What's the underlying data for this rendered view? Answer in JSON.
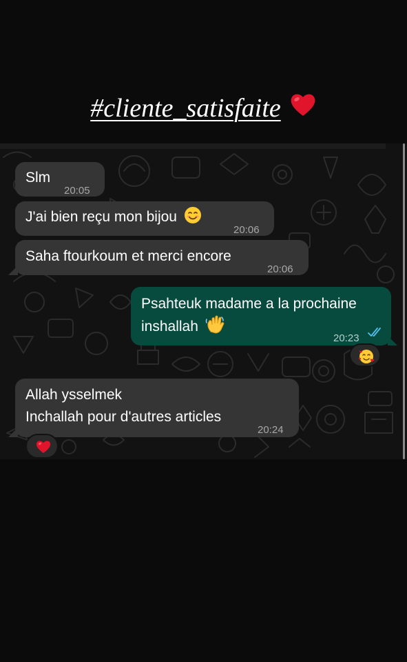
{
  "caption": {
    "text": "#cliente_satisfaite",
    "heart_icon": "red-heart-icon"
  },
  "chat": {
    "messages": [
      {
        "direction": "incoming",
        "text": "Slm",
        "time": "20:05"
      },
      {
        "direction": "incoming",
        "text": "J'ai bien reçu mon bijou",
        "emoji": "smiling-face-emoji",
        "time": "20:06"
      },
      {
        "direction": "incoming",
        "text": "Saha ftourkoum et merci encore",
        "time": "20:06"
      },
      {
        "direction": "outgoing",
        "lines": [
          "Psahteuk madame a la prochaine",
          "inshallah"
        ],
        "emoji": "waving-hand-emoji",
        "time": "20:23",
        "status": "read-double-check-icon",
        "reaction": "smiling-face-with-hearts-emoji"
      },
      {
        "direction": "incoming",
        "lines": [
          "Allah ysselmek",
          "Inchallah pour d'autres articles"
        ],
        "time": "20:24",
        "reaction": "red-heart-emoji"
      }
    ]
  },
  "colors": {
    "incoming_bubble": "#353535",
    "outgoing_bubble": "#074b3f",
    "read_ticks": "#53bdeb",
    "heart": "#e0152b",
    "chat_background": "#121212"
  }
}
